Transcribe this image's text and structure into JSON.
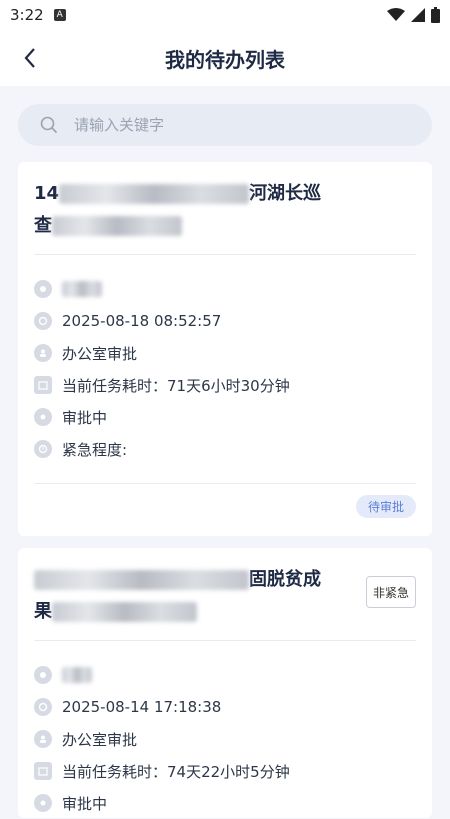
{
  "status_bar": {
    "time": "3:22",
    "app_icon": "A"
  },
  "header": {
    "title": "我的待办列表"
  },
  "search": {
    "placeholder": "请输入关键字"
  },
  "cards": [
    {
      "title_prefix": "14",
      "title_middle": "河湖长巡",
      "title_line2_prefix": "查",
      "title_line2_suffix": "",
      "time": "2025-08-18 08:52:57",
      "node": "办公室审批",
      "duration": "当前任务耗时：71天6小时30分钟",
      "state": "审批中",
      "urgency_label": "紧急程度:",
      "action": "待审批"
    },
    {
      "title_prefix": "",
      "title_middle": "固脱贫成",
      "title_line2_prefix": "果",
      "title_line2_suffix": "",
      "time": "2025-08-14 17:18:38",
      "node": "办公室审批",
      "duration": "当前任务耗时：74天22小时5分钟",
      "state": "审批中",
      "badge": "非紧急"
    }
  ],
  "icons": [
    "back-chevron-icon",
    "search-icon",
    "user-icon",
    "clock-icon",
    "person-icon",
    "calendar-icon",
    "status-icon",
    "urgency-icon",
    "wifi-icon",
    "signal-icon",
    "battery-icon"
  ],
  "colors": {
    "accent": "#5c7fd6",
    "tag_bg": "#e4eafa",
    "title": "#1f2a44"
  }
}
